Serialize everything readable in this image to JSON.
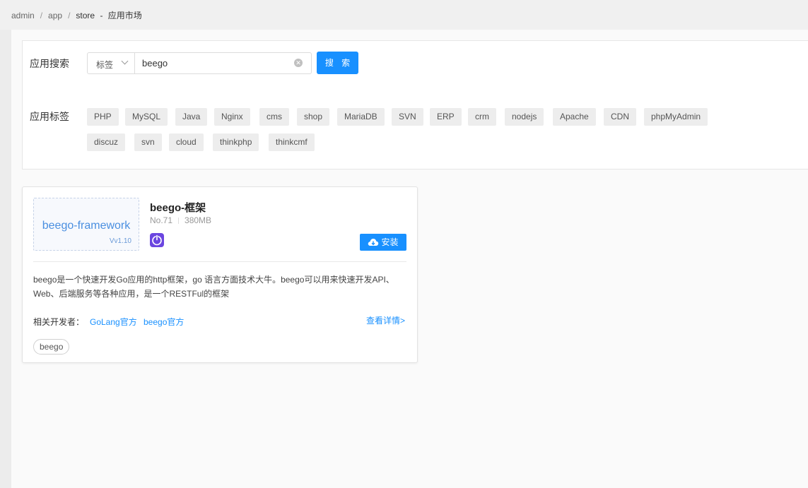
{
  "breadcrumb": {
    "items": [
      "admin",
      "app",
      "store"
    ],
    "separator": "/",
    "page_title": "应用市场",
    "title_dash": "-"
  },
  "search": {
    "label": "应用搜索",
    "select_value": "标签",
    "input_value": "beego",
    "button_label": "搜 索"
  },
  "tags": {
    "label": "应用标签",
    "items": [
      "PHP",
      "MySQL",
      "Java",
      "Nginx",
      "cms",
      "shop",
      "MariaDB",
      "SVN",
      "ERP",
      "crm",
      "nodejs",
      "Apache",
      "CDN",
      "phpMyAdmin",
      "discuz",
      "svn",
      "cloud",
      "thinkphp",
      "thinkcmf"
    ]
  },
  "app_card": {
    "thumb_title": "beego-framework",
    "thumb_version": "Vv1.10",
    "name": "beego-框架",
    "number": "No.71",
    "size": "380MB",
    "install_label": "安装",
    "description": "beego是一个快速开发Go应用的http框架，go 语言方面技术大牛。beego可以用来快速开发API、Web、后端服务等各种应用，是一个RESTFul的框架",
    "developers_label": "相关开发者：",
    "developers": [
      "GoLang官方",
      "beego官方"
    ],
    "detail_link": "查看详情>",
    "tag": "beego"
  },
  "colors": {
    "accent": "#1890ff",
    "app_icon": "#6b46e0"
  }
}
